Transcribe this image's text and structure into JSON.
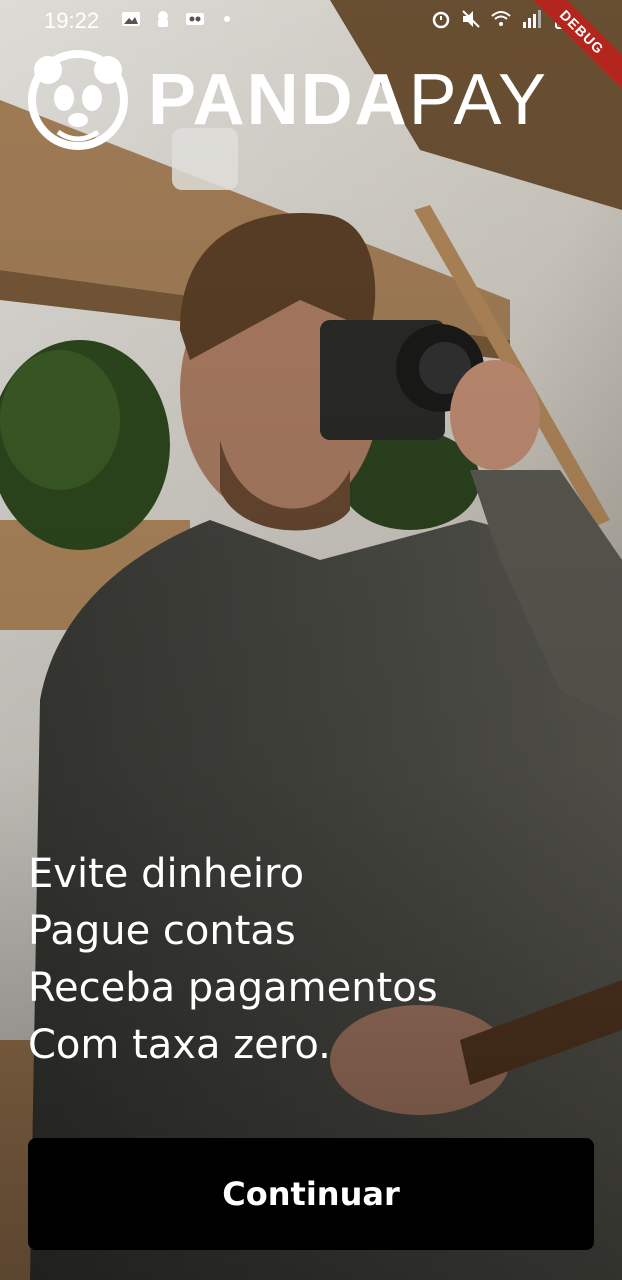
{
  "status_bar": {
    "time": "19:22",
    "debug_label": "DEBUG",
    "left_icons": [
      "gallery-icon",
      "android-notification-icon",
      "voicemail-icon",
      "dot-icon"
    ],
    "right_icons": [
      "alarm-icon",
      "mute-icon",
      "wifi-icon",
      "signal-icon",
      "battery-icon"
    ]
  },
  "brand": {
    "part_bold": "PANDA",
    "part_light": "PAY",
    "logo_icon": "panda-logo-icon"
  },
  "taglines": [
    "Evite dinheiro",
    "Pague contas",
    "Receba pagamentos",
    "Com taxa zero."
  ],
  "continue_button": {
    "label": "Continuar"
  },
  "colors": {
    "button_bg": "#000000",
    "text": "#ffffff",
    "debug_ribbon": "#b3261e"
  }
}
